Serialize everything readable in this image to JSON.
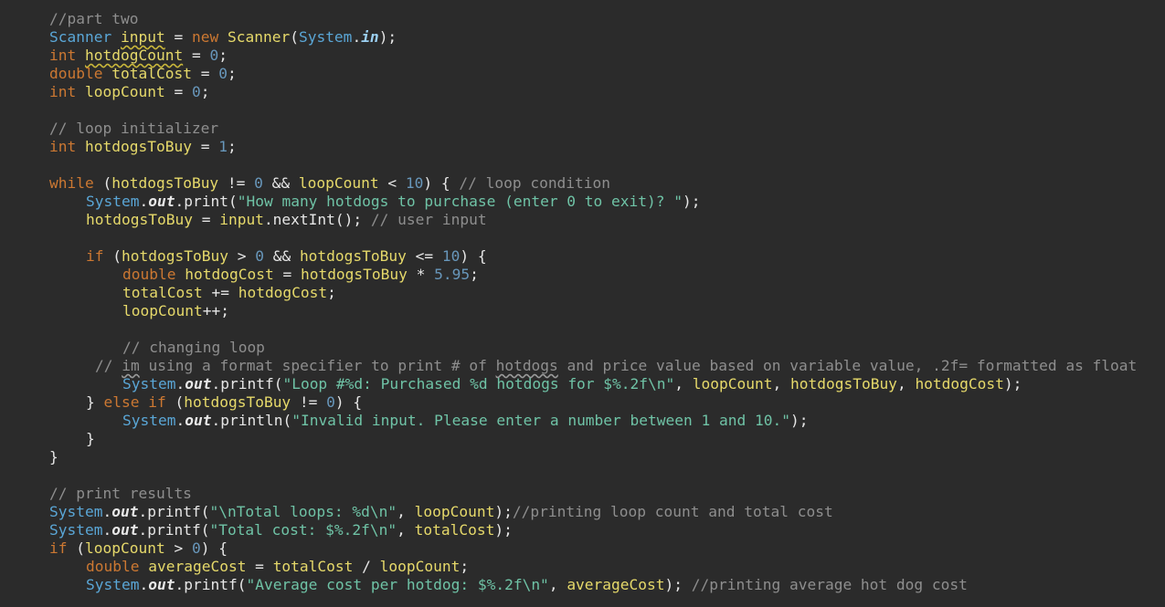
{
  "editor": {
    "lines": [
      {
        "row": 0,
        "indent": 0,
        "tokens": [
          {
            "t": "comment",
            "v": "//part two"
          }
        ]
      },
      {
        "row": 1,
        "indent": 0,
        "tokens": [
          {
            "t": "cls",
            "v": "Scanner"
          },
          {
            "t": "plain",
            "v": " "
          },
          {
            "t": "ident",
            "v": "input",
            "w": "warn"
          },
          {
            "t": "plain",
            "v": " = "
          },
          {
            "t": "keyword",
            "v": "new"
          },
          {
            "t": "plain",
            "v": " "
          },
          {
            "t": "ident",
            "v": "Scanner"
          },
          {
            "t": "plain",
            "v": "("
          },
          {
            "t": "cls",
            "v": "System"
          },
          {
            "t": "plain",
            "v": "."
          },
          {
            "t": "field-in",
            "v": "in"
          },
          {
            "t": "plain",
            "v": ");"
          }
        ]
      },
      {
        "row": 2,
        "indent": 0,
        "tokens": [
          {
            "t": "keyword",
            "v": "int"
          },
          {
            "t": "plain",
            "v": " "
          },
          {
            "t": "ident",
            "v": "hotdogCount",
            "w": "warn"
          },
          {
            "t": "plain",
            "v": " = "
          },
          {
            "t": "num",
            "v": "0"
          },
          {
            "t": "plain",
            "v": ";"
          }
        ]
      },
      {
        "row": 3,
        "indent": 0,
        "tokens": [
          {
            "t": "keyword",
            "v": "double"
          },
          {
            "t": "plain",
            "v": " "
          },
          {
            "t": "ident",
            "v": "totalCost"
          },
          {
            "t": "plain",
            "v": " = "
          },
          {
            "t": "num",
            "v": "0"
          },
          {
            "t": "plain",
            "v": ";"
          }
        ]
      },
      {
        "row": 4,
        "indent": 0,
        "tokens": [
          {
            "t": "keyword",
            "v": "int"
          },
          {
            "t": "plain",
            "v": " "
          },
          {
            "t": "ident",
            "v": "loopCount"
          },
          {
            "t": "plain",
            "v": " = "
          },
          {
            "t": "num",
            "v": "0"
          },
          {
            "t": "plain",
            "v": ";"
          }
        ]
      },
      {
        "row": 6,
        "indent": 0,
        "tokens": [
          {
            "t": "comment",
            "v": "// loop initializer"
          }
        ]
      },
      {
        "row": 7,
        "indent": 0,
        "tokens": [
          {
            "t": "keyword",
            "v": "int"
          },
          {
            "t": "plain",
            "v": " "
          },
          {
            "t": "ident",
            "v": "hotdogsToBuy"
          },
          {
            "t": "plain",
            "v": " = "
          },
          {
            "t": "num",
            "v": "1"
          },
          {
            "t": "plain",
            "v": ";"
          }
        ]
      },
      {
        "row": 9,
        "indent": 0,
        "tokens": [
          {
            "t": "keyword",
            "v": "while"
          },
          {
            "t": "plain",
            "v": " ("
          },
          {
            "t": "ident",
            "v": "hotdogsToBuy"
          },
          {
            "t": "plain",
            "v": " != "
          },
          {
            "t": "num",
            "v": "0"
          },
          {
            "t": "plain",
            "v": " && "
          },
          {
            "t": "ident",
            "v": "loopCount"
          },
          {
            "t": "plain",
            "v": " < "
          },
          {
            "t": "num",
            "v": "10"
          },
          {
            "t": "plain",
            "v": ") { "
          },
          {
            "t": "comment",
            "v": "// loop condition"
          }
        ]
      },
      {
        "row": 10,
        "indent": 1,
        "tokens": [
          {
            "t": "cls",
            "v": "System"
          },
          {
            "t": "plain",
            "v": "."
          },
          {
            "t": "field",
            "v": "out"
          },
          {
            "t": "plain",
            "v": ".print("
          },
          {
            "t": "str",
            "v": "\"How many hotdogs to purchase (enter 0 to exit)? \""
          },
          {
            "t": "plain",
            "v": ");"
          }
        ]
      },
      {
        "row": 11,
        "indent": 1,
        "tokens": [
          {
            "t": "ident",
            "v": "hotdogsToBuy"
          },
          {
            "t": "plain",
            "v": " = "
          },
          {
            "t": "ident",
            "v": "input"
          },
          {
            "t": "plain",
            "v": ".nextInt(); "
          },
          {
            "t": "comment",
            "v": "// user input"
          }
        ]
      },
      {
        "row": 13,
        "indent": 1,
        "tokens": [
          {
            "t": "keyword",
            "v": "if"
          },
          {
            "t": "plain",
            "v": " ("
          },
          {
            "t": "ident",
            "v": "hotdogsToBuy"
          },
          {
            "t": "plain",
            "v": " > "
          },
          {
            "t": "num",
            "v": "0"
          },
          {
            "t": "plain",
            "v": " && "
          },
          {
            "t": "ident",
            "v": "hotdogsToBuy"
          },
          {
            "t": "plain",
            "v": " <= "
          },
          {
            "t": "num",
            "v": "10"
          },
          {
            "t": "plain",
            "v": ") {"
          }
        ]
      },
      {
        "row": 14,
        "indent": 2,
        "tokens": [
          {
            "t": "keyword",
            "v": "double"
          },
          {
            "t": "plain",
            "v": " "
          },
          {
            "t": "ident",
            "v": "hotdogCost"
          },
          {
            "t": "plain",
            "v": " = "
          },
          {
            "t": "ident",
            "v": "hotdogsToBuy"
          },
          {
            "t": "plain",
            "v": " * "
          },
          {
            "t": "num",
            "v": "5.95"
          },
          {
            "t": "plain",
            "v": ";"
          }
        ]
      },
      {
        "row": 15,
        "indent": 2,
        "tokens": [
          {
            "t": "ident",
            "v": "totalCost"
          },
          {
            "t": "plain",
            "v": " += "
          },
          {
            "t": "ident",
            "v": "hotdogCost"
          },
          {
            "t": "plain",
            "v": ";"
          }
        ]
      },
      {
        "row": 16,
        "indent": 2,
        "tokens": [
          {
            "t": "ident",
            "v": "loopCount"
          },
          {
            "t": "plain",
            "v": "++;"
          }
        ]
      },
      {
        "row": 18,
        "indent": 2,
        "tokens": [
          {
            "t": "comment",
            "v": "// changing loop"
          }
        ]
      },
      {
        "row": 19,
        "indent": 1.25,
        "tokens": [
          {
            "t": "comment",
            "v": "// "
          },
          {
            "t": "comment",
            "v": "im",
            "w": "warn-gray"
          },
          {
            "t": "comment",
            "v": " using a format specifier to print # of "
          },
          {
            "t": "comment",
            "v": "hotdogs",
            "w": "warn-gray"
          },
          {
            "t": "comment",
            "v": " and price value based on variable value, .2f= formatted as float"
          }
        ]
      },
      {
        "row": 20,
        "indent": 2,
        "tokens": [
          {
            "t": "cls",
            "v": "System"
          },
          {
            "t": "plain",
            "v": "."
          },
          {
            "t": "field",
            "v": "out"
          },
          {
            "t": "plain",
            "v": ".printf("
          },
          {
            "t": "str",
            "v": "\"Loop #%d: Purchased %d hotdogs for $%.2f\\n\""
          },
          {
            "t": "plain",
            "v": ", "
          },
          {
            "t": "ident",
            "v": "loopCount"
          },
          {
            "t": "plain",
            "v": ", "
          },
          {
            "t": "ident",
            "v": "hotdogsToBuy"
          },
          {
            "t": "plain",
            "v": ", "
          },
          {
            "t": "ident",
            "v": "hotdogCost"
          },
          {
            "t": "plain",
            "v": ");"
          }
        ]
      },
      {
        "row": 21,
        "indent": 1,
        "tokens": [
          {
            "t": "plain",
            "v": "} "
          },
          {
            "t": "keyword",
            "v": "else if"
          },
          {
            "t": "plain",
            "v": " ("
          },
          {
            "t": "ident",
            "v": "hotdogsToBuy"
          },
          {
            "t": "plain",
            "v": " != "
          },
          {
            "t": "num",
            "v": "0"
          },
          {
            "t": "plain",
            "v": ") {"
          }
        ]
      },
      {
        "row": 22,
        "indent": 2,
        "tokens": [
          {
            "t": "cls",
            "v": "System"
          },
          {
            "t": "plain",
            "v": "."
          },
          {
            "t": "field",
            "v": "out"
          },
          {
            "t": "plain",
            "v": ".println("
          },
          {
            "t": "str",
            "v": "\"Invalid input. Please enter a number between 1 and 10.\""
          },
          {
            "t": "plain",
            "v": ");"
          }
        ]
      },
      {
        "row": 23,
        "indent": 1,
        "tokens": [
          {
            "t": "plain",
            "v": "}"
          }
        ]
      },
      {
        "row": 24,
        "indent": 0,
        "tokens": [
          {
            "t": "plain",
            "v": "}"
          }
        ]
      },
      {
        "row": 26,
        "indent": 0,
        "tokens": [
          {
            "t": "comment",
            "v": "// print results"
          }
        ]
      },
      {
        "row": 27,
        "indent": 0,
        "tokens": [
          {
            "t": "cls",
            "v": "System"
          },
          {
            "t": "plain",
            "v": "."
          },
          {
            "t": "field",
            "v": "out"
          },
          {
            "t": "plain",
            "v": ".printf("
          },
          {
            "t": "str",
            "v": "\"\\nTotal loops: %d\\n\""
          },
          {
            "t": "plain",
            "v": ", "
          },
          {
            "t": "ident",
            "v": "loopCount"
          },
          {
            "t": "plain",
            "v": ");"
          },
          {
            "t": "comment",
            "v": "//printing loop count and total cost"
          }
        ]
      },
      {
        "row": 28,
        "indent": 0,
        "tokens": [
          {
            "t": "cls",
            "v": "System"
          },
          {
            "t": "plain",
            "v": "."
          },
          {
            "t": "field",
            "v": "out"
          },
          {
            "t": "plain",
            "v": ".printf("
          },
          {
            "t": "str",
            "v": "\"Total cost: $%.2f\\n\""
          },
          {
            "t": "plain",
            "v": ", "
          },
          {
            "t": "ident",
            "v": "totalCost"
          },
          {
            "t": "plain",
            "v": ");"
          }
        ]
      },
      {
        "row": 29,
        "indent": 0,
        "tokens": [
          {
            "t": "keyword",
            "v": "if"
          },
          {
            "t": "plain",
            "v": " ("
          },
          {
            "t": "ident",
            "v": "loopCount"
          },
          {
            "t": "plain",
            "v": " > "
          },
          {
            "t": "num",
            "v": "0"
          },
          {
            "t": "plain",
            "v": ") {"
          }
        ]
      },
      {
        "row": 30,
        "indent": 1,
        "tokens": [
          {
            "t": "keyword",
            "v": "double"
          },
          {
            "t": "plain",
            "v": " "
          },
          {
            "t": "ident",
            "v": "averageCost"
          },
          {
            "t": "plain",
            "v": " = "
          },
          {
            "t": "ident",
            "v": "totalCost"
          },
          {
            "t": "plain",
            "v": " / "
          },
          {
            "t": "ident",
            "v": "loopCount"
          },
          {
            "t": "plain",
            "v": ";"
          }
        ]
      },
      {
        "row": 31,
        "indent": 1,
        "tokens": [
          {
            "t": "cls",
            "v": "System"
          },
          {
            "t": "plain",
            "v": "."
          },
          {
            "t": "field",
            "v": "out"
          },
          {
            "t": "plain",
            "v": ".printf("
          },
          {
            "t": "str",
            "v": "\"Average cost per hotdog: $%.2f\\n\""
          },
          {
            "t": "plain",
            "v": ", "
          },
          {
            "t": "ident",
            "v": "averageCost"
          },
          {
            "t": "plain",
            "v": "); "
          },
          {
            "t": "comment",
            "v": "//printing average hot dog cost"
          }
        ]
      }
    ]
  }
}
